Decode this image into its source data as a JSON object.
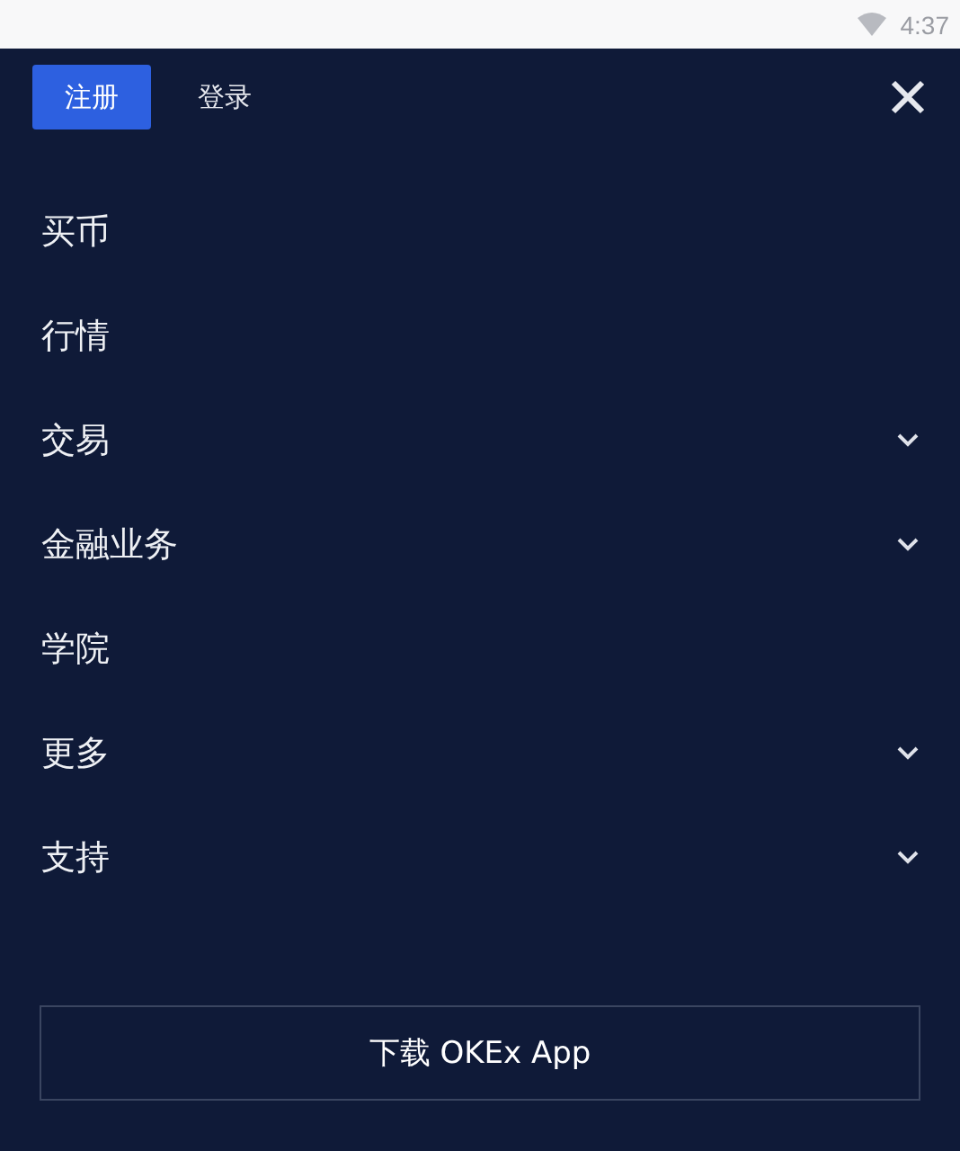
{
  "status_bar": {
    "time": "4:37"
  },
  "header": {
    "buttons": [
      {
        "label": "注册",
        "selected": true
      },
      {
        "label": "登录",
        "selected": false
      }
    ]
  },
  "menu": [
    {
      "label": "买币",
      "kind": "link"
    },
    {
      "label": "行情",
      "kind": "link"
    },
    {
      "label": "交易",
      "kind": "dropdown"
    },
    {
      "label": "金融业务",
      "kind": "dropdown"
    },
    {
      "label": "学院",
      "kind": "link"
    },
    {
      "label": "更多",
      "kind": "dropdown"
    },
    {
      "label": "支持",
      "kind": "dropdown"
    }
  ],
  "download_button": {
    "label": "下载 OKEx App"
  }
}
